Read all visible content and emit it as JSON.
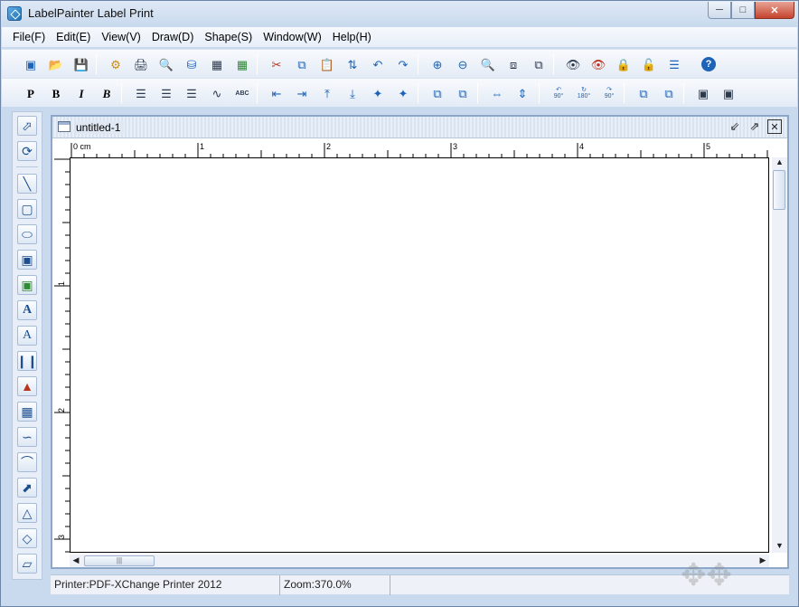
{
  "window": {
    "title": "LabelPainter Label Print"
  },
  "menu": {
    "items": [
      "File(F)",
      "Edit(E)",
      "View(V)",
      "Draw(D)",
      "Shape(S)",
      "Window(W)",
      "Help(H)"
    ]
  },
  "toolbar_text": {
    "plain": "P",
    "bold": "B",
    "italic": "I",
    "bold_italic": "B",
    "abc": "ABC",
    "rot90": "90°",
    "rot180": "180°",
    "rot90b": "90°"
  },
  "document": {
    "title": "untitled-1",
    "ruler_unit": "0 cm",
    "h_ticks": [
      "1",
      "2",
      "3",
      "4",
      "5"
    ],
    "v_ticks": [
      "1",
      "2",
      "3"
    ]
  },
  "status": {
    "printer": "Printer:PDF-XChange Printer 2012",
    "zoom": "Zoom:370.0%"
  },
  "colors": {
    "frame": "#c9daee",
    "accent": "#1d63b8"
  }
}
